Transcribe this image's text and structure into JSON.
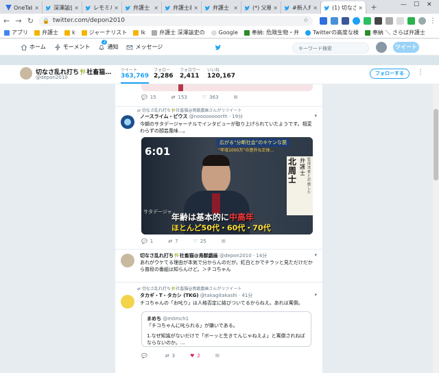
{
  "browser": {
    "tabs": [
      {
        "label": "OneTab",
        "color": "#2f6fde"
      },
      {
        "label": "深澤諭史",
        "color": "#1da1f2"
      },
      {
        "label": "レモミル",
        "color": "#1da1f2"
      },
      {
        "label": "弁護士",
        "color": "#1da1f2"
      },
      {
        "label": "弁護士ね",
        "color": "#1da1f2"
      },
      {
        "label": "弁護士",
        "color": "#1da1f2"
      },
      {
        "label": "(*) 父親",
        "color": "#1da1f2"
      },
      {
        "label": "#新人弁",
        "color": "#1da1f2"
      },
      {
        "label": "(1) 切なさ",
        "color": "#1da1f2"
      }
    ],
    "new_tab": "+",
    "url": "twitter.com/depon2010",
    "bookmarks": [
      {
        "label": "アプリ",
        "color": "#4285f4"
      },
      {
        "label": "弁護士",
        "color": "#f4b400"
      },
      {
        "label": "k",
        "color": "#f4b400"
      },
      {
        "label": "ジャーナリスト",
        "color": "#f4b400"
      },
      {
        "label": "lk",
        "color": "#f4b400"
      },
      {
        "label": "弁護士 深澤諭史の",
        "color": "#aaaaaa"
      },
      {
        "label": "Google",
        "color": "#dddddd"
      },
      {
        "label": "奉納: 危険生物・弁",
        "color": "#2a8c2a"
      },
      {
        "label": "Twitterの高度な検",
        "color": "#1da1f2"
      },
      {
        "label": "奉納 ＼ さらば弁護士",
        "color": "#2a8c2a"
      }
    ]
  },
  "twitter_nav": {
    "home": "ホーム",
    "moments": "モーメント",
    "notifications": "通知",
    "notif_count": "2",
    "messages": "メッセージ",
    "search_placeholder": "キーワード検索",
    "tweet_button": "ツイート"
  },
  "profile": {
    "name": "切なさ乱れ打ち🎋社畜猫…",
    "handle": "@depon2010",
    "stats": [
      {
        "label": "ツイート",
        "value": "363,769"
      },
      {
        "label": "フォロー",
        "value": "2,286"
      },
      {
        "label": "フォロワー",
        "value": "2,411"
      },
      {
        "label": "いいね",
        "value": "120,167"
      }
    ],
    "follow_button": "フォローする"
  },
  "tweets": [
    {
      "replies": "15",
      "retweets": "153",
      "likes": "363"
    },
    {
      "retweet_note": "切なさ乱れ打ち🎋社畜猫@鳥獣戯画さんがリツイート",
      "name": "ノースライム・ピウス",
      "handle": "@noooooooorth · 19分",
      "text": "今朝のサタデージャーナルでインタビューが取り上げられていたようです。相変わらずの顔芸風味…。",
      "media": {
        "clock": "6:01",
        "top_caption": "広がる“分断社会”のキケンな罠",
        "sub_caption": "“年収1000万”の意外な正体…",
        "side_text": [
          "弁護士",
          "北周士"
        ],
        "side_text2": "堅成流者と対面した",
        "bottom_line1": "年齢は基本的に",
        "bottom_highlight": "中高年",
        "bottom_line2": "ほとんど50代・60代・70代",
        "channel": "サタデージャ"
      },
      "replies": "1",
      "retweets": "7",
      "likes": "25"
    },
    {
      "name": "切なさ乱れ打ち🎋社畜猫@鳥獣戯画",
      "handle": "@depon2010 · 14分",
      "text": "あれがウケてる理由が本気で分からんのだが。紅白とかでチラッと見ただけだから普段の番組は知らんけど。＞チコちゃん"
    },
    {
      "retweet_note": "切なさ乱れ打ち🎋社畜猫@鳥獣戯画さんがリツイート",
      "name": "タカギ・T・タカシ (TKG)",
      "handle": "@takagitakashi · 41分",
      "text": "チコちゃんの「お叱り」は人格否定に結びついてるからねえ。あれは罵倒。",
      "quote": {
        "name": "まめち",
        "handle": "@m0mch1",
        "line1": "「チコちゃんに叱られる」が嫌いである。",
        "line2": "1.なぜ知識がないだけで「ボーッと生きてんじゃねえよ」と罵倒されねばならないのか。..."
      },
      "replies": "",
      "retweets": "3",
      "likes": "2"
    }
  ]
}
